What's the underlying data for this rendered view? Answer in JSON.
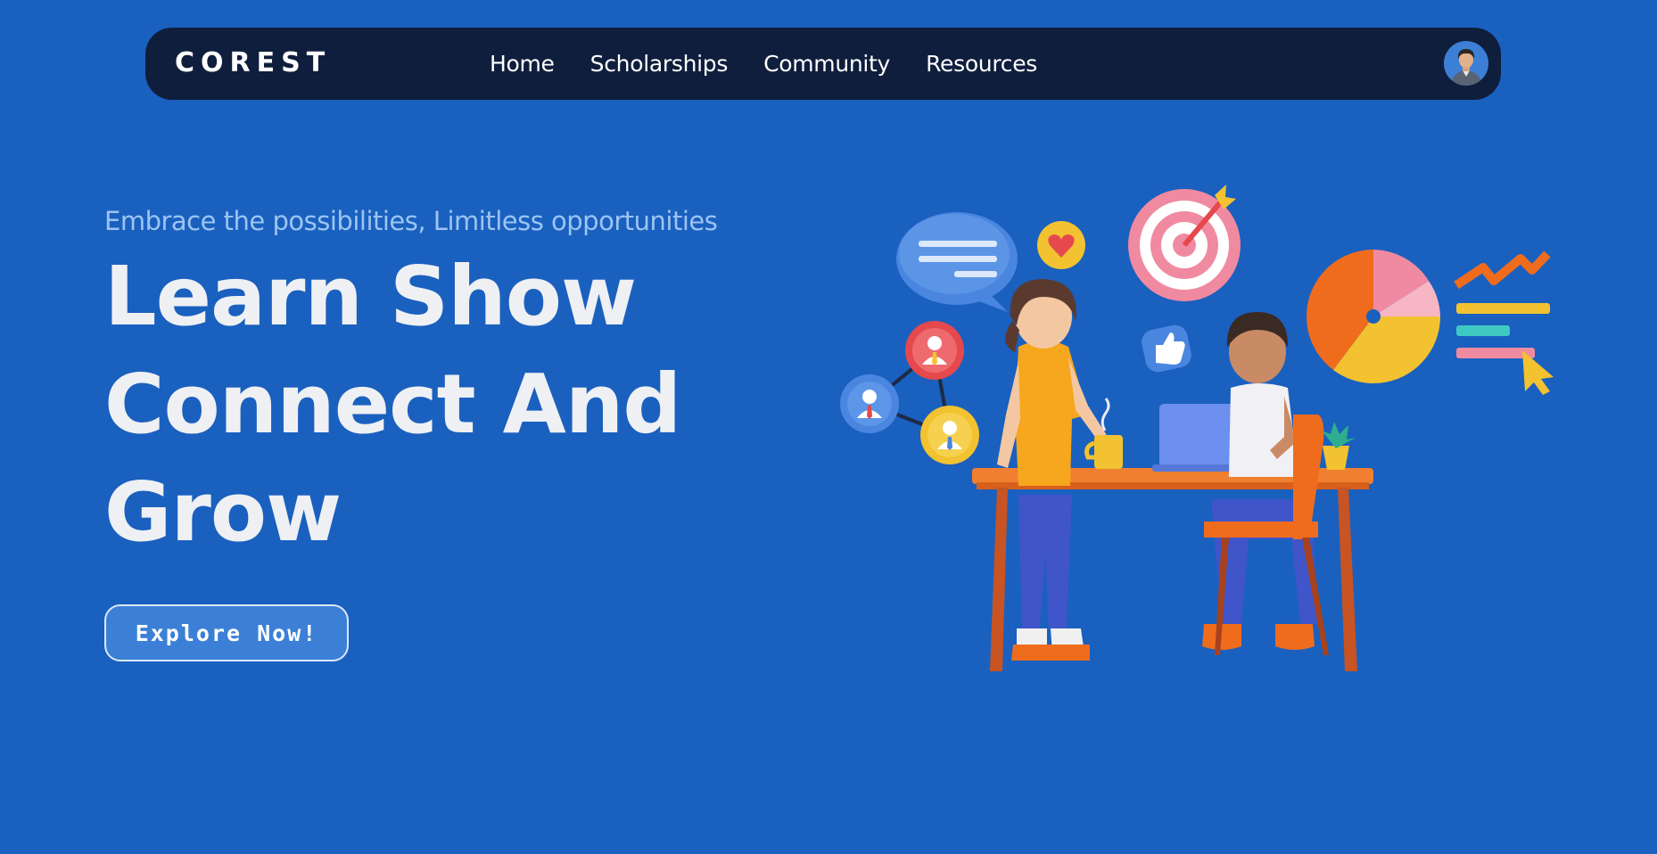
{
  "nav": {
    "logo": "COREST",
    "links": [
      "Home",
      "Scholarships",
      "Community",
      "Resources"
    ],
    "avatar_icon": "user-avatar-icon"
  },
  "hero": {
    "tagline": "Embrace the possibilities, Limitless opportunities",
    "headline_lines": [
      "Learn Show",
      "Connect And",
      "Grow"
    ],
    "cta_label": "Explore Now!"
  },
  "colors": {
    "background": "#1a60bf",
    "navbar": "#0f1e3c",
    "tagline": "#9cc4f2",
    "headline": "#eef0f3",
    "button": "#3b80d6"
  },
  "illustration": {
    "icons": [
      "chat-bubble-icon",
      "heart-icon",
      "target-icon",
      "like-icon",
      "network-icon",
      "pie-chart-icon",
      "trend-icon",
      "cursor-icon",
      "people-at-desk-illustration"
    ]
  }
}
